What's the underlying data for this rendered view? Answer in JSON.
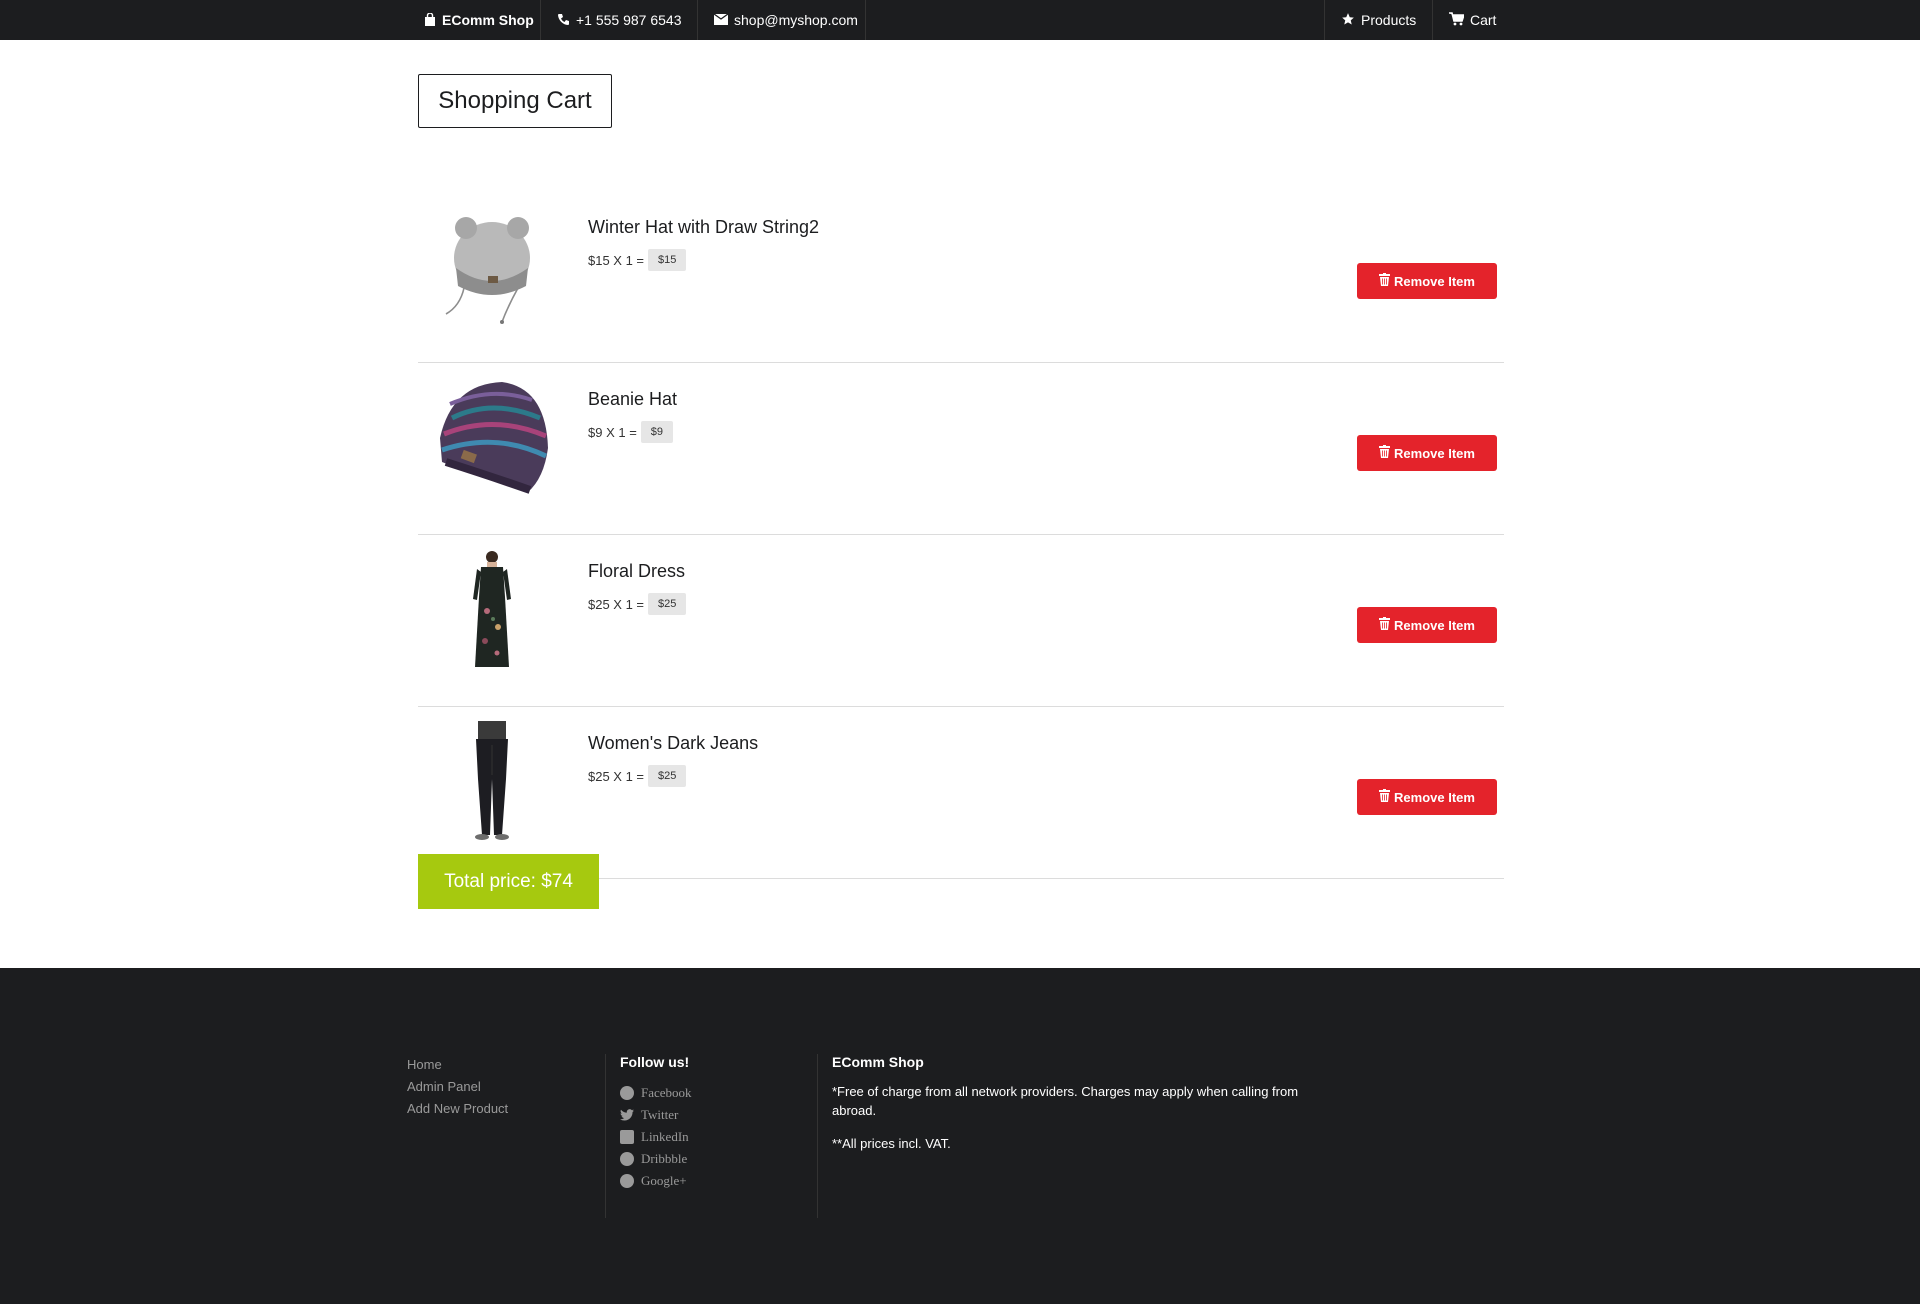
{
  "nav": {
    "brand": "EComm Shop",
    "phone": "+1 555 987 6543",
    "email": "shop@myshop.com",
    "products": "Products",
    "cart": "Cart"
  },
  "page": {
    "title": "Shopping Cart"
  },
  "items": [
    {
      "name": "Winter Hat with Draw String2",
      "price_line": "$15 X 1 =",
      "subtotal": "$15",
      "remove_label": "Remove Item"
    },
    {
      "name": "Beanie Hat",
      "price_line": "$9 X 1 =",
      "subtotal": "$9",
      "remove_label": "Remove Item"
    },
    {
      "name": "Floral Dress",
      "price_line": "$25 X 1 =",
      "subtotal": "$25",
      "remove_label": "Remove Item"
    },
    {
      "name": "Women's Dark Jeans",
      "price_line": "$25 X 1 =",
      "subtotal": "$25",
      "remove_label": "Remove Item"
    }
  ],
  "total": "Total price: $74",
  "footer": {
    "links": [
      "Home",
      "Admin Panel",
      "Add New Product"
    ],
    "follow_title": "Follow us!",
    "social": [
      "Facebook",
      "Twitter",
      "LinkedIn",
      "Dribbble",
      "Google+"
    ],
    "shop_title": "EComm Shop",
    "note1": "*Free of charge from all network providers. Charges may apply when calling from abroad.",
    "note2": "**All prices incl. VAT."
  },
  "colors": {
    "dark": "#1c1d1f",
    "remove": "#e4232b",
    "total": "#a6c90f"
  }
}
